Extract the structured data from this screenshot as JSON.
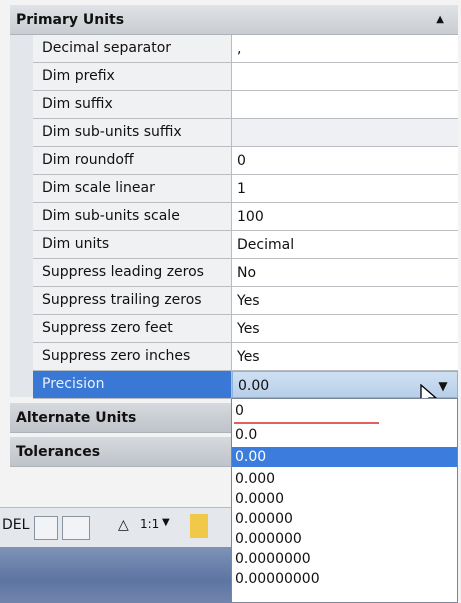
{
  "primary_units": {
    "title": "Primary Units",
    "rows": [
      {
        "name": "Decimal separator",
        "value": ","
      },
      {
        "name": "Dim prefix",
        "value": ""
      },
      {
        "name": "Dim suffix",
        "value": ""
      },
      {
        "name": "Dim sub-units suffix",
        "value": ""
      },
      {
        "name": "Dim roundoff",
        "value": "0"
      },
      {
        "name": "Dim scale linear",
        "value": "1"
      },
      {
        "name": "Dim sub-units scale",
        "value": "100"
      },
      {
        "name": "Dim units",
        "value": "Decimal"
      },
      {
        "name": "Suppress leading zeros",
        "value": "No"
      },
      {
        "name": "Suppress trailing zeros",
        "value": "Yes"
      },
      {
        "name": "Suppress zero feet",
        "value": "Yes"
      },
      {
        "name": "Suppress zero inches",
        "value": "Yes"
      },
      {
        "name": "Precision",
        "value": "0.00"
      }
    ]
  },
  "alternate_units": {
    "title": "Alternate Units"
  },
  "tolerances": {
    "title": "Tolerances"
  },
  "precision_options": [
    "0",
    "0.0",
    "0.00",
    "0.000",
    "0.0000",
    "0.00000",
    "0.000000",
    "0.0000000",
    "0.00000000"
  ],
  "selected_precision": "0.00",
  "status_bar": {
    "model_label": "DEL",
    "scale_label": "1:1"
  },
  "colors": {
    "selection": "#3a78d6",
    "highlight": "#3b7cdc",
    "header": "#d0d4d9"
  }
}
